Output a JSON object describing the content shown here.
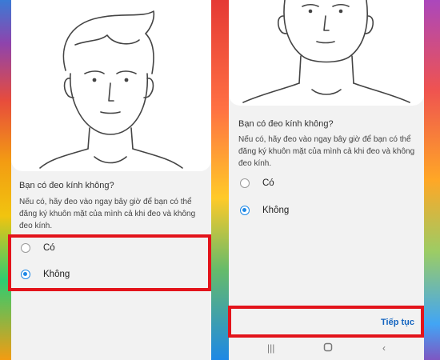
{
  "left_screen": {
    "question": "Bạn có đeo kính không?",
    "description": "Nếu có, hãy đeo vào ngay bây giờ để bạn có thể đăng ký khuôn mặt của mình cả khi đeo và không đeo kính.",
    "options": [
      {
        "label": "Có",
        "selected": false
      },
      {
        "label": "Không",
        "selected": true
      }
    ]
  },
  "right_screen": {
    "question": "Bạn có đeo kính không?",
    "description": "Nếu có, hãy đeo vào ngay bây giờ để bạn có thể đăng ký khuôn mặt của mình cả khi đeo và không đeo kính.",
    "options": [
      {
        "label": "Có",
        "selected": false
      },
      {
        "label": "Không",
        "selected": true
      }
    ],
    "continue_label": "Tiếp tục"
  },
  "navbar": {
    "icons": [
      "recent-apps-icon",
      "home-icon",
      "back-icon"
    ]
  },
  "colors": {
    "accent": "#1e88e5",
    "highlight": "#e3141b",
    "continue_text": "#1565c0"
  }
}
